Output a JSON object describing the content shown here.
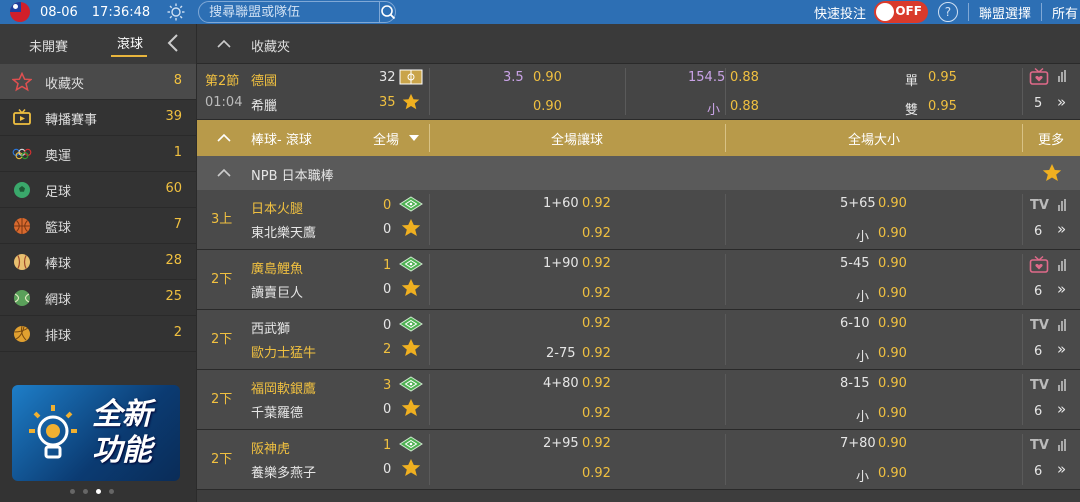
{
  "topbar": {
    "date": "08-06",
    "time": "17:36:48",
    "search_placeholder": "搜尋聯盟或隊伍",
    "quick_bet": "快速投注",
    "toggle_label": "OFF",
    "league_select": "聯盟選擇",
    "all_label": "所有",
    "colors": {
      "bar": "#2d6fb4",
      "toggle": "#d93a2b"
    }
  },
  "sidebar": {
    "tabs": {
      "upcoming": "未開賽",
      "live": "滾球"
    },
    "items": [
      {
        "icon": "star-icon",
        "label": "收藏夾",
        "count": "8"
      },
      {
        "icon": "tv-icon",
        "label": "轉播賽事",
        "count": "39"
      },
      {
        "icon": "olympic-rings-icon",
        "label": "奧運",
        "count": "1"
      },
      {
        "icon": "soccer-ball-icon",
        "label": "足球",
        "count": "60"
      },
      {
        "icon": "basketball-icon",
        "label": "籃球",
        "count": "7"
      },
      {
        "icon": "baseball-icon",
        "label": "棒球",
        "count": "28"
      },
      {
        "icon": "tennis-ball-icon",
        "label": "網球",
        "count": "25"
      },
      {
        "icon": "volleyball-icon",
        "label": "排球",
        "count": "2"
      }
    ],
    "banner": {
      "text": "全新功能"
    }
  },
  "favorites": {
    "title": "收藏夾",
    "match": {
      "period": "第2節",
      "clock": "01:04",
      "home": "德國",
      "away": "希臘",
      "home_score": "32",
      "away_score": "35",
      "handicap_line": "3.5",
      "handicap_home": "0.90",
      "handicap_away": "0.90",
      "total_line": "154.5",
      "total_over": "0.88",
      "total_under_label": "小",
      "total_under": "0.88",
      "odd_label": "單",
      "odd_value": "0.95",
      "even_label": "雙",
      "even_value": "0.95",
      "more_count": "5"
    }
  },
  "category_bar": {
    "sport": "棒球- 滾球",
    "period": "全場",
    "col_handicap": "全場讓球",
    "col_total": "全場大小",
    "col_more": "更多"
  },
  "league": {
    "name": "NPB 日本職棒"
  },
  "matches": [
    {
      "inning": "3上",
      "home": "日本火腿",
      "away": "東北樂天鷹",
      "home_score": "0",
      "away_score": "0",
      "home_gold": true,
      "away_gold": false,
      "hdp_line_home": "1+60",
      "hdp_home": "0.92",
      "hdp_line_away": "",
      "hdp_away": "0.92",
      "ou_line": "5+65",
      "ou_over": "0.90",
      "ou_under_label": "小",
      "ou_under": "0.90",
      "media": "TV",
      "more": "6"
    },
    {
      "inning": "2下",
      "home": "廣島鯉魚",
      "away": "讀賣巨人",
      "home_score": "1",
      "away_score": "0",
      "home_gold": true,
      "away_gold": false,
      "hdp_line_home": "1+90",
      "hdp_home": "0.92",
      "hdp_line_away": "",
      "hdp_away": "0.92",
      "ou_line": "5-45",
      "ou_over": "0.90",
      "ou_under_label": "小",
      "ou_under": "0.90",
      "media": "live-tv",
      "more": "6"
    },
    {
      "inning": "2下",
      "home": "西武獅",
      "away": "歐力士猛牛",
      "home_score": "0",
      "away_score": "2",
      "home_gold": false,
      "away_gold": true,
      "hdp_line_home": "",
      "hdp_home": "0.92",
      "hdp_line_away": "2-75",
      "hdp_away": "0.92",
      "ou_line": "6-10",
      "ou_over": "0.90",
      "ou_under_label": "小",
      "ou_under": "0.90",
      "media": "TV",
      "more": "6"
    },
    {
      "inning": "2下",
      "home": "福岡軟銀鷹",
      "away": "千葉羅德",
      "home_score": "3",
      "away_score": "0",
      "home_gold": true,
      "away_gold": false,
      "hdp_line_home": "4+80",
      "hdp_home": "0.92",
      "hdp_line_away": "",
      "hdp_away": "0.92",
      "ou_line": "8-15",
      "ou_over": "0.90",
      "ou_under_label": "小",
      "ou_under": "0.90",
      "media": "TV",
      "more": "6"
    },
    {
      "inning": "2下",
      "home": "阪神虎",
      "away": "養樂多燕子",
      "home_score": "1",
      "away_score": "0",
      "home_gold": true,
      "away_gold": false,
      "hdp_line_home": "2+95",
      "hdp_home": "0.92",
      "hdp_line_away": "",
      "hdp_away": "0.92",
      "ou_line": "7+80",
      "ou_over": "0.90",
      "ou_under_label": "小",
      "ou_under": "0.90",
      "media": "TV",
      "more": "6"
    }
  ]
}
